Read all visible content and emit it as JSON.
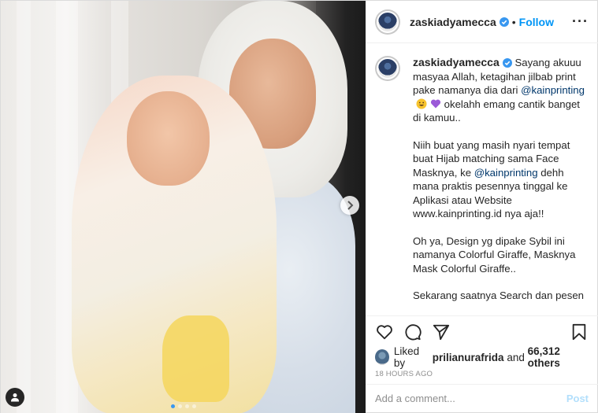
{
  "post": {
    "username": "zaskiadyamecca",
    "follow_label": "Follow",
    "separator": "•",
    "more_label": "···",
    "caption": {
      "line1_text": "Sayang akuuu masyaa Allah, ketagihan jilbab print pake namanya dia dari",
      "mention1": "@kainprinting",
      "line1_tail": "okelahh emang cantik banget di kamuu..",
      "para2_a": "Niih buat yang masih nyari tempat buat Hijab matching sama Face Masknya, ke",
      "mention2": "@kainprinting",
      "para2_b": "dehh mana praktis pesennya tinggal ke Aplikasi atau Website www.kainprinting.id nya aja!!",
      "para3": "Oh ya, Design yg dipake Sybil ini namanya Colorful Giraffe, Masknya Mask Colorful Giraffe..",
      "para4": "Sekarang saatnya Search dan pesen"
    },
    "likes": {
      "liked_by_label": "Liked by",
      "liker": "prilianurafrida",
      "and_label": "and",
      "others": "66,312 others"
    },
    "timestamp": "18 HOURS AGO",
    "comment": {
      "placeholder": "Add a comment...",
      "post_label": "Post"
    }
  },
  "carousel": {
    "dot_count": 4,
    "active_index": 0
  },
  "icons": {
    "verified": "verified-badge-icon",
    "like": "heart-icon",
    "comment": "comment-bubble-icon",
    "share": "send-icon",
    "save": "bookmark-icon",
    "next": "chevron-right-icon",
    "user_tag": "user-tag-icon"
  },
  "colors": {
    "link": "#0095f6",
    "mention": "#00376b",
    "verified": "#3897f0",
    "muted": "#8e8e8e"
  }
}
